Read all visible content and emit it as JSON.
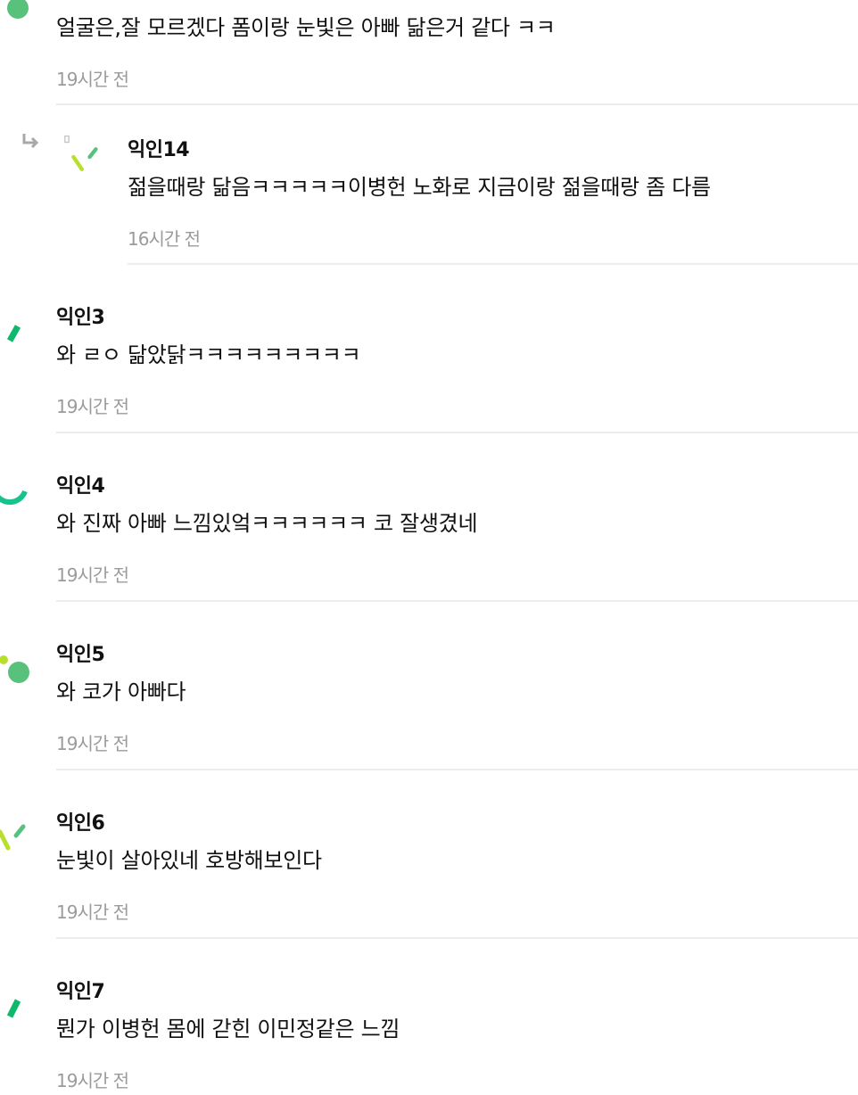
{
  "comments": [
    {
      "author": "",
      "text": "얼굴은,잘 모르겠다 폼이랑 눈빛은 아빠 닮은거 같다 ㅋㅋ",
      "time": "19시간 전",
      "avatar_icon": "avatar-green-dot-icon"
    },
    {
      "author": "익인14",
      "text": "젊을때랑 닮음ㅋㅋㅋㅋㅋ이병헌 노화로 지금이랑 젊을때랑 좀 다름",
      "time": "16시간 전",
      "is_reply": true,
      "avatar_icon": "avatar-yellow-green-strokes-icon"
    },
    {
      "author": "익인3",
      "text": "와 ㄹㅇ 닮았닭ㅋㅋㅋㅋㅋㅋㅋㅋㅋ",
      "time": "19시간 전",
      "avatar_icon": "avatar-green-stroke-icon"
    },
    {
      "author": "익인4",
      "text": "와 진짜 아빠 느낌있엌ㅋㅋㅋㅋㅋㅋ 코 잘생겼네",
      "time": "19시간 전",
      "avatar_icon": "avatar-teal-arc-icon"
    },
    {
      "author": "익인5",
      "text": "와 코가 아빠다",
      "time": "19시간 전",
      "avatar_icon": "avatar-green-dots-icon"
    },
    {
      "author": "익인6",
      "text": "눈빛이 살아있네 호방해보인다",
      "time": "19시간 전",
      "avatar_icon": "avatar-yellow-green-strokes-icon"
    },
    {
      "author": "익인7",
      "text": "뭔가 이병헌 몸에 갇힌 이민정같은 느낌",
      "time": "19시간 전",
      "avatar_icon": "avatar-green-stroke-icon"
    }
  ],
  "reply_icon": "reply-arrow-icon",
  "colors": {
    "text": "#111111",
    "muted": "#9b9b9b",
    "divider": "#ececec",
    "green": "#58c27d",
    "teal": "#17c28c",
    "lime": "#b8df2c"
  }
}
